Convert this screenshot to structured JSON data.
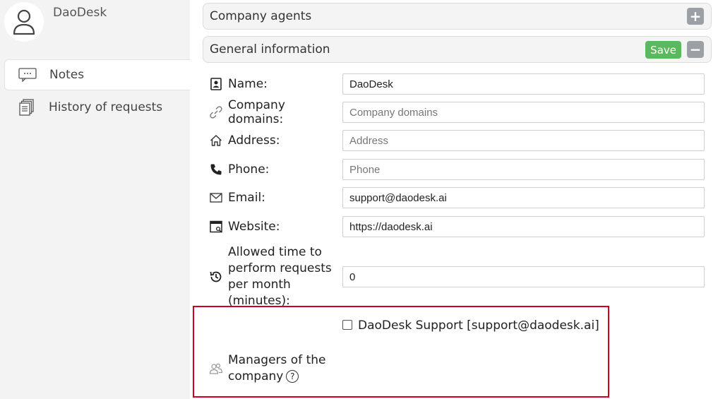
{
  "sidebar": {
    "company_name": "DaoDesk",
    "items": [
      {
        "label": "Notes",
        "icon": "chat-bubble-icon"
      },
      {
        "label": "History of requests",
        "icon": "documents-icon"
      }
    ]
  },
  "panels": {
    "agents": {
      "title": "Company agents",
      "toggle": "+"
    },
    "general": {
      "title": "General information",
      "save_label": "Save",
      "toggle": "−"
    }
  },
  "fields": {
    "name": {
      "label": "Name:",
      "value": "DaoDesk",
      "placeholder": ""
    },
    "domains": {
      "label": "Company domains:",
      "value": "",
      "placeholder": "Company domains"
    },
    "address": {
      "label": "Address:",
      "value": "",
      "placeholder": "Address"
    },
    "phone": {
      "label": "Phone:",
      "value": "",
      "placeholder": "Phone"
    },
    "email": {
      "label": "Email:",
      "value": "support@daodesk.ai",
      "placeholder": ""
    },
    "website": {
      "label": "Website:",
      "value": "https://daodesk.ai",
      "placeholder": ""
    },
    "allowed_time": {
      "label": "Allowed time to perform requests per month (minutes):",
      "value": "0",
      "placeholder": ""
    }
  },
  "managers": {
    "label": "Managers of the company",
    "help": "?",
    "options": [
      {
        "label": "DaoDesk Support [support@daodesk.ai]",
        "checked": false
      }
    ]
  },
  "colors": {
    "save": "#5cb85c",
    "highlight": "#d0021b"
  }
}
